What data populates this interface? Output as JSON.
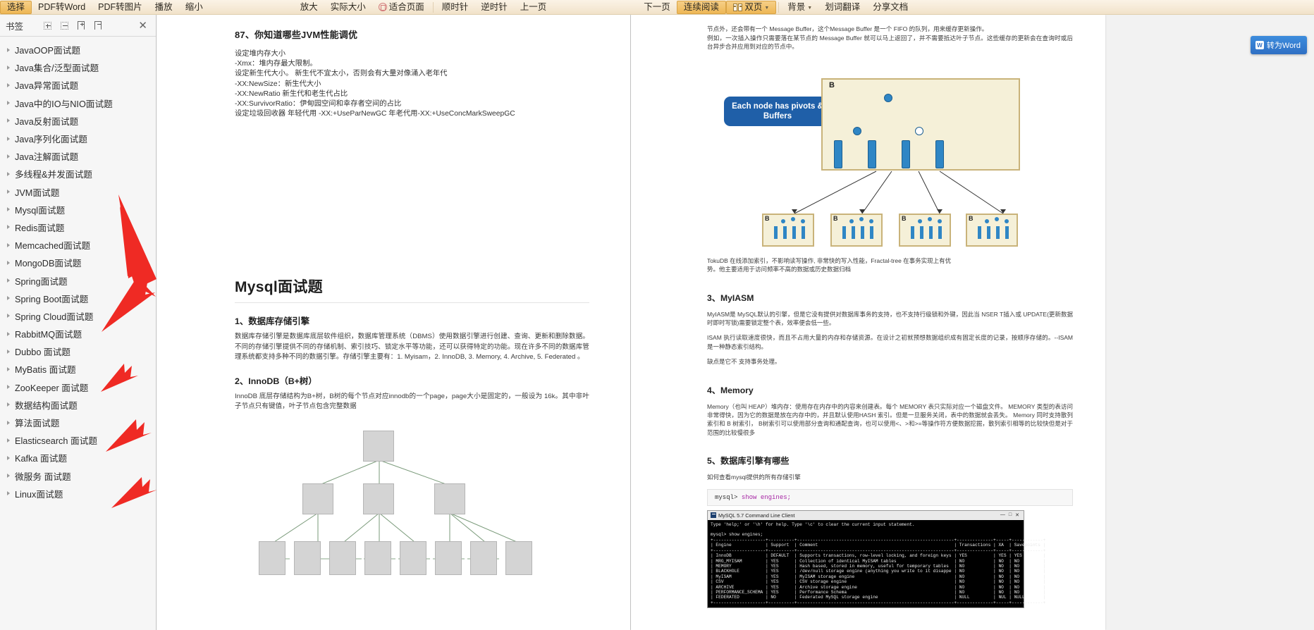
{
  "toolbar": {
    "items": [
      {
        "label": "选择",
        "name": "select-tool",
        "active": true
      },
      {
        "label": "PDF转Word",
        "name": "pdf-to-word"
      },
      {
        "label": "PDF转图片",
        "name": "pdf-to-image"
      },
      {
        "label": "播放",
        "name": "play"
      },
      {
        "label": "缩小",
        "name": "zoom-out"
      },
      {
        "label": "放大",
        "name": "zoom-in"
      },
      {
        "label": "实际大小",
        "name": "actual-size"
      },
      {
        "label": "适合页面",
        "name": "fit-page",
        "icon": "fit-page-icon"
      },
      {
        "label": "顺时针",
        "name": "rotate-clockwise"
      },
      {
        "label": "逆时针",
        "name": "rotate-counterclockwise"
      },
      {
        "label": "上一页",
        "name": "previous-page"
      },
      {
        "label": "下一页",
        "name": "next-page"
      },
      {
        "label": "连续阅读",
        "name": "continuous-reading",
        "active": true
      },
      {
        "label": "双页",
        "name": "dual-page",
        "icon": "dual-page-icon",
        "caret": true,
        "active": true
      },
      {
        "label": "背景",
        "name": "background",
        "caret": true
      },
      {
        "label": "划词翻译",
        "name": "word-translate"
      },
      {
        "label": "分享文档",
        "name": "share-document"
      }
    ]
  },
  "sidebar": {
    "title": "书签",
    "buttons": [
      {
        "name": "expand-all-button",
        "icon": "expand-all-icon"
      },
      {
        "name": "collapse-all-button",
        "icon": "collapse-all-icon"
      },
      {
        "name": "add-bookmark-button",
        "icon": "bookmark-plus-icon"
      },
      {
        "name": "remove-bookmark-button",
        "icon": "bookmark-minus-icon"
      }
    ],
    "close_label": "✕",
    "items": [
      {
        "label": "JavaOOP面试题"
      },
      {
        "label": "Java集合/泛型面试题"
      },
      {
        "label": "Java异常面试题"
      },
      {
        "label": "Java中的IO与NIO面试题"
      },
      {
        "label": "Java反射面试题"
      },
      {
        "label": "Java序列化面试题"
      },
      {
        "label": "Java注解面试题"
      },
      {
        "label": "多线程&并发面试题"
      },
      {
        "label": "JVM面试题"
      },
      {
        "label": "Mysql面试题"
      },
      {
        "label": "Redis面试题"
      },
      {
        "label": "Memcached面试题"
      },
      {
        "label": "MongoDB面试题"
      },
      {
        "label": "Spring面试题"
      },
      {
        "label": "Spring Boot面试题"
      },
      {
        "label": "Spring Cloud面试题"
      },
      {
        "label": "RabbitMQ面试题"
      },
      {
        "label": "Dubbo 面试题"
      },
      {
        "label": "MyBatis 面试题"
      },
      {
        "label": "ZooKeeper 面试题"
      },
      {
        "label": "数据结构面试题"
      },
      {
        "label": "算法面试题"
      },
      {
        "label": "Elasticsearch 面试题"
      },
      {
        "label": "Kafka 面试题"
      },
      {
        "label": "微服务 面试题"
      },
      {
        "label": "Linux面试题"
      }
    ]
  },
  "left_page": {
    "heading": "87、你知道哪些JVM性能调优",
    "lines": [
      "设定堆内存大小",
      "-Xmx：堆内存最大限制。",
      "设定新生代大小。 新生代不宜太小，否则会有大量对像涌入老年代",
      "-XX:NewSize：新生代大小",
      "-XX:NewRatio 新生代和老生代占比",
      "-XX:SurvivorRatio：伊甸园空间和幸存者空间的占比",
      "设定垃圾回收器 年轻代用 -XX:+UseParNewGC 年老代用-XX:+UseConcMarkSweepGC"
    ],
    "title": "Mysql面试题",
    "section1_title": "1、数据库存储引擎",
    "section1_text": "数据库存储引擎是数据库底层软件组织，数据库管理系统（DBMS）使用数据引擎进行创建、查询、更新和删除数据。不同的存储引擎提供不同的存储机制、索引技巧、锁定水平等功能，还可以获得特定的功能。现在许多不同的数据库管理系统都支持多种不同的数据引擎。存储引擎主要有：1. Myisam，2. InnoDB, 3. Memory, 4. Archive, 5. Federated 。",
    "section2_title": "2、InnoDB（B+树）",
    "section2_text": "InnoDB 底层存储结构为B+树，B树的每个节点对应innodb的一个page，page大小是固定的，一般设为 16k。其中非叶子节点只有键值，叶子节点包含完整数据"
  },
  "right_page": {
    "top_text": "节点外，还会带有一个 Message Buffer，这个Message Buffer 是一个 FIFO 的队列，用来缓存更新操作。\n例如，一次插入操作只需要落在某节点的 Message Buffer 就可以马上返回了，并不需要抵达叶子节点。这些缓存的更新会在查询时或后台异步合并应用到对应的节点中。",
    "callout": "Each node has pivots & Buffers",
    "node_label": "B",
    "after_diagram_text": "TokuDB 在线添加索引，不影响读写操作, 非常快的写入性能，Fractal-tree 在事务实现上有优\n势。他主要适用于访问频率不高的数据或历史数据归档",
    "section3_title": "3、MyIASM",
    "section3_p1": "MyIASM是 MySQL默认的引擎，但是它没有提供对数据库事务的支持，也不支持行级锁和外键，因此当 NSER T插入或 UPDATE(更新数据时即时写锁)需要锁定整个表，效率便会低一些。",
    "section3_p2": "ISAM 执行读取速度很快，而且不占用大量的内存和存储资源。在设计之初就预想数据组织成有固定长度的记录，按顺序存储的。--ISAM 是一种静态索引结构。",
    "section3_p3": "缺点是它不 支持事务处理。",
    "section4_title": "4、Memory",
    "section4_p1": "Memory（也叫 HEAP）堆内存：使用存在内存中的内容来创建表。每个 MEMORY 表只实际对应一个磁盘文件。 MEMORY 类型的表访问非常得快，因为它的数据是放在内存中的，并且默认使用HASH 索引。但是一旦服务关闭，表中的数据就会丢失。 Memory 同时支持散列索引和 B 树索引， B树索引可以使用部分查询和通配查询，也可以使用<、>和>=等操作符方便数据挖掘，散列索引相等的比较快但是对于范围的比较慢很多",
    "section5_title": "5、数据库引擎有哪些",
    "section5_p": "如何查看mysql提供的所有存储引擎",
    "code_prompt": "mysql>",
    "code_command": "show engines;",
    "terminal": {
      "title": "MySQL 5.7 Command Line Client",
      "controls": [
        "—",
        "□",
        "✕"
      ],
      "lines": [
        "Type 'help;' or '\\h' for help. Type '\\c' to clear the current input statement.",
        "",
        "mysql> show engines;"
      ],
      "table_headers": [
        "Engine",
        "Support",
        "Comment",
        "Transactions",
        "XA",
        "Savepoints"
      ],
      "table_rows": [
        [
          "InnoDB",
          "DEFAULT",
          "Supports transactions, row-level locking, and foreign keys",
          "YES",
          "YES",
          "YES"
        ],
        [
          "MRG_MYISAM",
          "YES",
          "Collection of identical MyISAM tables",
          "NO",
          "NO",
          "NO"
        ],
        [
          "MEMORY",
          "YES",
          "Hash based, stored in memory, useful for temporary tables",
          "NO",
          "NO",
          "NO"
        ],
        [
          "BLACKHOLE",
          "YES",
          "/dev/null storage engine (anything you write to it disappears)",
          "NO",
          "NO",
          "NO"
        ],
        [
          "MyISAM",
          "YES",
          "MyISAM storage engine",
          "NO",
          "NO",
          "NO"
        ],
        [
          "CSV",
          "YES",
          "CSV storage engine",
          "NO",
          "NO",
          "NO"
        ],
        [
          "ARCHIVE",
          "YES",
          "Archive storage engine",
          "NO",
          "NO",
          "NO"
        ],
        [
          "PERFORMANCE_SCHEMA",
          "YES",
          "Performance Schema",
          "NO",
          "NO",
          "NO"
        ],
        [
          "FEDERATED",
          "NO",
          "Federated MySQL storage engine",
          "NULL",
          "NULL",
          "NULL"
        ]
      ]
    }
  },
  "floating": {
    "word_button_label": "转为Word",
    "word_button_icon": "word-icon"
  },
  "colors": {
    "toolbar_accent": "#efb955",
    "callout_blue": "#1f5fa8",
    "node_fill": "#f5f0d8",
    "node_border": "#c9b37a",
    "bar_blue": "#2f86c5",
    "arrow_red": "#ef2a24",
    "word_btn": "#3d8ddd"
  }
}
